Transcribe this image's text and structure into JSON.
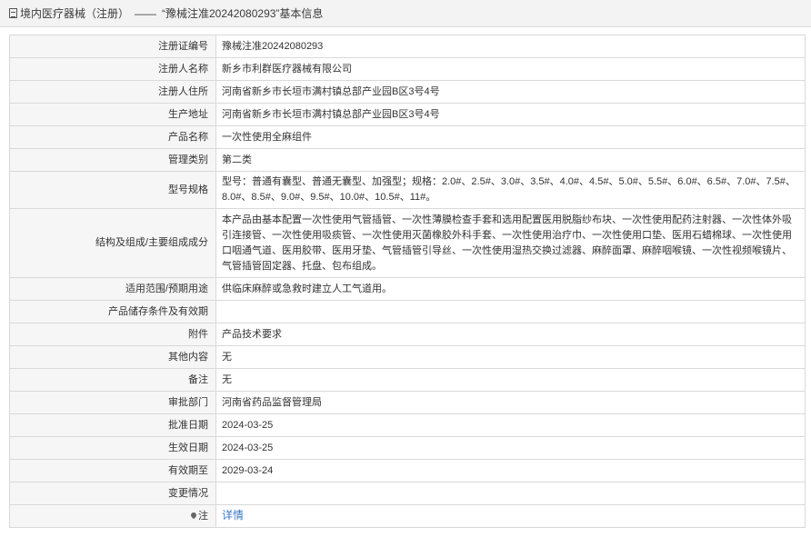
{
  "header": {
    "category": "境内医疗器械（注册）",
    "separator": "——",
    "record_title": "“豫械注准20242080293”基本信息"
  },
  "rows": [
    {
      "label": "注册证编号",
      "value": "豫械注准20242080293"
    },
    {
      "label": "注册人名称",
      "value": "新乡市利群医疗器械有限公司"
    },
    {
      "label": "注册人住所",
      "value": "河南省新乡市长垣市满村镇总部产业园B区3号4号"
    },
    {
      "label": "生产地址",
      "value": "河南省新乡市长垣市满村镇总部产业园B区3号4号"
    },
    {
      "label": "产品名称",
      "value": "一次性使用全麻组件"
    },
    {
      "label": "管理类别",
      "value": "第二类"
    },
    {
      "label": "型号规格",
      "value": "型号：普通有囊型、普通无囊型、加强型；规格：2.0#、2.5#、3.0#、3.5#、4.0#、4.5#、5.0#、5.5#、6.0#、6.5#、7.0#、7.5#、8.0#、8.5#、9.0#、9.5#、10.0#、10.5#、11#。"
    },
    {
      "label": "结构及组成/主要组成成分",
      "value": "本产品由基本配置一次性使用气管插管、一次性薄膜检查手套和选用配置医用脱脂纱布块、一次性使用配药注射器、一次性体外吸引连接管、一次性使用吸痰管、一次性使用灭菌橡胶外科手套、一次性使用治疗巾、一次性使用口垫、医用石蜡棉球、一次性使用口咽通气道、医用胶带、医用牙垫、气管插管引导丝、一次性使用湿热交换过滤器、麻醉面罩、麻醉咽喉镜、一次性视频喉镜片、气管插管固定器、托盘、包布组成。"
    },
    {
      "label": "适用范围/预期用途",
      "value": "供临床麻醉或急救时建立人工气道用。"
    },
    {
      "label": "产品储存条件及有效期",
      "value": ""
    },
    {
      "label": "附件",
      "value": "产品技术要求"
    },
    {
      "label": "其他内容",
      "value": "无"
    },
    {
      "label": "备注",
      "value": "无"
    },
    {
      "label": "审批部门",
      "value": "河南省药品监督管理局"
    },
    {
      "label": "批准日期",
      "value": "2024-03-25"
    },
    {
      "label": "生效日期",
      "value": "2024-03-25"
    },
    {
      "label": "有效期至",
      "value": "2029-03-24"
    },
    {
      "label": "变更情况",
      "value": ""
    }
  ],
  "note_row": {
    "label": "注",
    "link_text": "详情",
    "icon": "pin-icon"
  },
  "colors": {
    "link": "#3a77c9",
    "label_bg": "#f6f6f6",
    "border": "#d9d9d9"
  }
}
